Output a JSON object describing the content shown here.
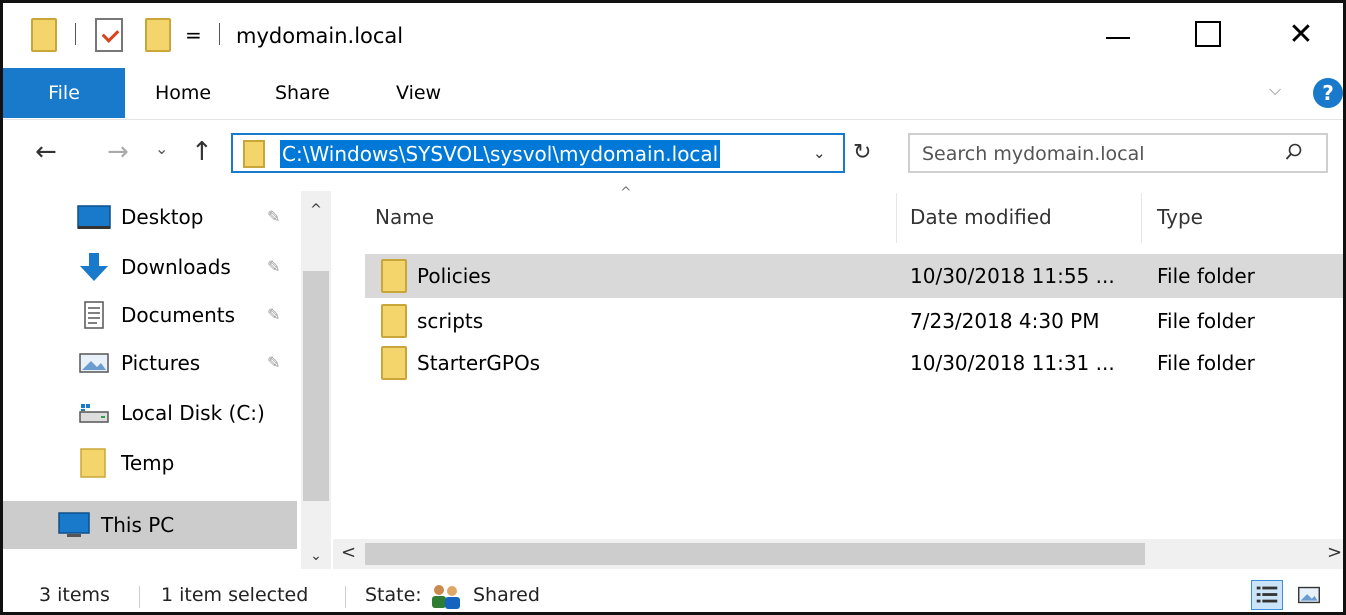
{
  "window": {
    "title": "mydomain.local",
    "quick_access_dropdown": "=",
    "minimize": "",
    "maximize": "",
    "close": "✕"
  },
  "ribbon": {
    "tabs": [
      "File",
      "Home",
      "Share",
      "View"
    ],
    "expand": "⌵",
    "help": "?"
  },
  "nav": {
    "back": "←",
    "forward": "→",
    "recent": "⌄",
    "up": "↑",
    "address": "C:\\Windows\\SYSVOL\\sysvol\\mydomain.local",
    "address_dropdown": "⌄",
    "refresh": "↻",
    "search_placeholder": "Search mydomain.local"
  },
  "sidebar": {
    "items": [
      {
        "label": "Desktop",
        "icon": "desktop-icon",
        "pinned": true
      },
      {
        "label": "Downloads",
        "icon": "downloads-icon",
        "pinned": true
      },
      {
        "label": "Documents",
        "icon": "documents-icon",
        "pinned": true
      },
      {
        "label": "Pictures",
        "icon": "pictures-icon",
        "pinned": true
      },
      {
        "label": "Local Disk (C:)",
        "icon": "local-disk-icon",
        "pinned": false
      },
      {
        "label": "Temp",
        "icon": "folder-icon",
        "pinned": false
      },
      {
        "label": "This PC",
        "icon": "this-pc-icon",
        "pinned": false,
        "selected": true
      }
    ],
    "pin_glyph": "📌",
    "scroll_up": "^",
    "scroll_down": "⌄"
  },
  "files": {
    "sort_indicator": "^",
    "columns": [
      "Name",
      "Date modified",
      "Type"
    ],
    "rows": [
      {
        "name": "Policies",
        "date": "10/30/2018 11:55 ...",
        "type": "File folder",
        "selected": true
      },
      {
        "name": "scripts",
        "date": "7/23/2018 4:30 PM",
        "type": "File folder",
        "selected": false
      },
      {
        "name": "StarterGPOs",
        "date": "10/30/2018 11:31 ...",
        "type": "File folder",
        "selected": false
      }
    ],
    "scroll_left": "<",
    "scroll_right": ">"
  },
  "status": {
    "item_count": "3 items",
    "selected": "1 item selected",
    "state_label": "State:",
    "state_value": "Shared"
  },
  "colors": {
    "accent": "#1979ca",
    "selection": "#0078d7",
    "folder": "#f4d56b"
  }
}
